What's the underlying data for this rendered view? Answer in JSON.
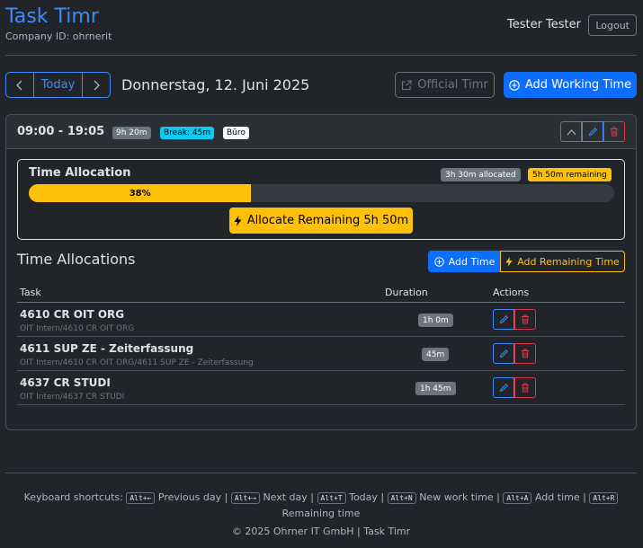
{
  "app": {
    "title": "Task Timr",
    "company": "Company ID: ohrnerit",
    "user": "Tester Tester",
    "logout_label": "Logout"
  },
  "datebar": {
    "today_label": "Today",
    "date": "Donnerstag, 12. Juni 2025",
    "official_label": "Official Timr",
    "add_working_label": "Add Working Time"
  },
  "entry": {
    "time_range": "09:00 - 19:05",
    "duration_badge": "9h 20m",
    "break_badge": "Break: 45m",
    "location_badge": "Büro",
    "allocation": {
      "title": "Time Allocation",
      "allocated_badge": "3h 30m allocated",
      "remaining_badge": "5h 50m remaining",
      "progress_percent": 38,
      "progress_label": "38%",
      "allocate_button": "Allocate Remaining 5h 50m"
    },
    "allocations_title": "Time Allocations",
    "add_time_label": "Add Time",
    "add_remaining_label": "Add Remaining Time",
    "table": {
      "headers": {
        "task": "Task",
        "duration": "Duration",
        "actions": "Actions"
      },
      "rows": [
        {
          "name": "4610 CR OIT ORG",
          "path": "OIT Intern/4610 CR OIT ORG",
          "duration": "1h 0m"
        },
        {
          "name": "4611 SUP ZE - Zeiterfassung",
          "path": "OIT Intern/4610 CR OIT ORG/4611 SUP ZE - Zeiterfassung",
          "duration": "45m"
        },
        {
          "name": "4637 CR STUDI",
          "path": "OIT Intern/4637 CR STUDI",
          "duration": "1h 45m"
        }
      ]
    }
  },
  "footer": {
    "shortcuts_label": "Keyboard shortcuts:",
    "shortcuts": [
      {
        "key": "Alt+←",
        "label": "Previous day |"
      },
      {
        "key": "Alt+→",
        "label": "Next day |"
      },
      {
        "key": "Alt+T",
        "label": "Today |"
      },
      {
        "key": "Alt+N",
        "label": "New work time |"
      },
      {
        "key": "Alt+A",
        "label": "Add time |"
      },
      {
        "key": "Alt+R",
        "label": "Remaining time"
      }
    ],
    "copyright": "© 2025 Ohrner IT GmbH | Task Timr"
  },
  "colors": {
    "primary": "#0d6efd",
    "warning": "#ffc107",
    "danger": "#dc3545",
    "info": "#0dcaf0",
    "background": "#212529"
  },
  "icons": [
    "chevron-left-icon",
    "chevron-right-icon",
    "external-link-icon",
    "plus-circle-icon",
    "chevron-up-icon",
    "pencil-icon",
    "trash-icon",
    "lightning-icon"
  ]
}
